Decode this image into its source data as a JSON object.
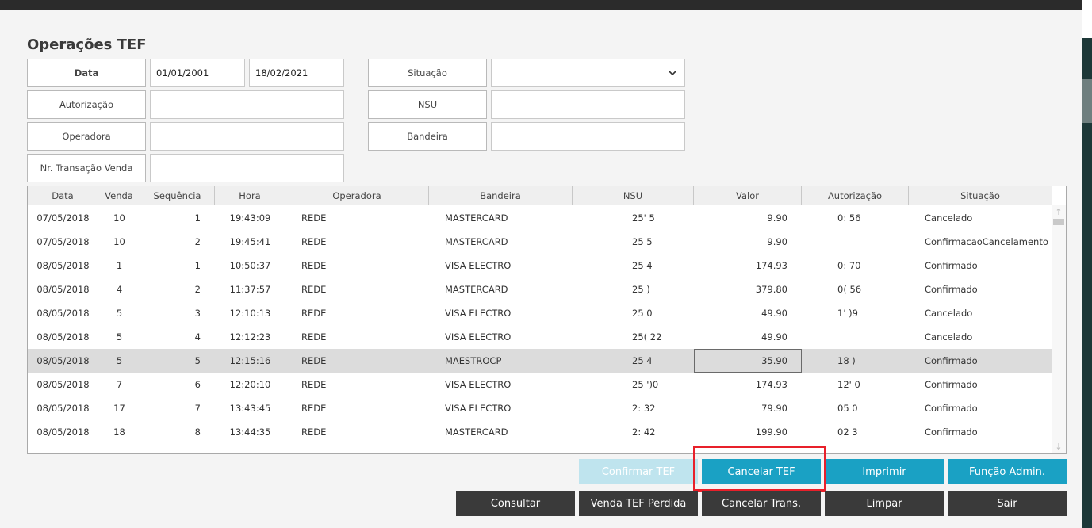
{
  "title": "Operações TEF",
  "filters": {
    "data_label": "Data",
    "data_from": "01/01/2001",
    "data_to": "18/02/2021",
    "autorizacao_label": "Autorização",
    "operadora_label": "Operadora",
    "nr_transacao_label": "Nr. Transação Venda",
    "situacao_label": "Situação",
    "situacao_value": "",
    "nsu_label": "NSU",
    "bandeira_label": "Bandeira"
  },
  "table": {
    "headers": [
      "Data",
      "Venda",
      "Sequência",
      "Hora",
      "Operadora",
      "Bandeira",
      "NSU",
      "Valor",
      "Autorização",
      "Situação"
    ],
    "rows": [
      {
        "data": "07/05/2018",
        "venda": "10",
        "seq": "1",
        "hora": "19:43:09",
        "operadora": "REDE",
        "bandeira": "MASTERCARD",
        "nsu": "25'      5",
        "valor": "9.90",
        "autorizacao": "0:   56",
        "situacao": "Cancelado"
      },
      {
        "data": "07/05/2018",
        "venda": "10",
        "seq": "2",
        "hora": "19:45:41",
        "operadora": "REDE",
        "bandeira": "MASTERCARD",
        "nsu": "25       5",
        "valor": "9.90",
        "autorizacao": "",
        "situacao": "ConfirmacaoCancelamento"
      },
      {
        "data": "08/05/2018",
        "venda": "1",
        "seq": "1",
        "hora": "10:50:37",
        "operadora": "REDE",
        "bandeira": "VISA ELECTRO",
        "nsu": "25       4",
        "valor": "174.93",
        "autorizacao": "0:   70",
        "situacao": "Confirmado"
      },
      {
        "data": "08/05/2018",
        "venda": "4",
        "seq": "2",
        "hora": "11:37:57",
        "operadora": "REDE",
        "bandeira": "MASTERCARD",
        "nsu": "25       )",
        "valor": "379.80",
        "autorizacao": "0(   56",
        "situacao": "Confirmado"
      },
      {
        "data": "08/05/2018",
        "venda": "5",
        "seq": "3",
        "hora": "12:10:13",
        "operadora": "REDE",
        "bandeira": "VISA ELECTRO",
        "nsu": "25       0",
        "valor": "49.90",
        "autorizacao": "1'   )9",
        "situacao": "Cancelado"
      },
      {
        "data": "08/05/2018",
        "venda": "5",
        "seq": "4",
        "hora": "12:12:23",
        "operadora": "REDE",
        "bandeira": "VISA ELECTRO",
        "nsu": "25(     22",
        "valor": "49.90",
        "autorizacao": "",
        "situacao": "Cancelado"
      },
      {
        "data": "08/05/2018",
        "venda": "5",
        "seq": "5",
        "hora": "12:15:16",
        "operadora": "REDE",
        "bandeira": "MAESTROCP",
        "nsu": "25       4",
        "valor": "35.90",
        "autorizacao": "18   )",
        "situacao": "Confirmado"
      },
      {
        "data": "08/05/2018",
        "venda": "7",
        "seq": "6",
        "hora": "12:20:10",
        "operadora": "REDE",
        "bandeira": "VISA ELECTRO",
        "nsu": "25    ')0",
        "valor": "174.93",
        "autorizacao": "12'  0",
        "situacao": "Confirmado"
      },
      {
        "data": "08/05/2018",
        "venda": "17",
        "seq": "7",
        "hora": "13:43:45",
        "operadora": "REDE",
        "bandeira": "VISA ELECTRO",
        "nsu": "2:      32",
        "valor": "79.90",
        "autorizacao": "05   0",
        "situacao": "Confirmado"
      },
      {
        "data": "08/05/2018",
        "venda": "18",
        "seq": "8",
        "hora": "13:44:35",
        "operadora": "REDE",
        "bandeira": "MASTERCARD",
        "nsu": "2:      42",
        "valor": "199.90",
        "autorizacao": "02   3",
        "situacao": "Confirmado"
      }
    ]
  },
  "buttons": {
    "confirmar_tef": "Confirmar TEF",
    "cancelar_tef": "Cancelar TEF",
    "imprimir": "Imprimir",
    "funcao_admin": "Função Admin.",
    "consultar": "Consultar",
    "venda_tef_perdida": "Venda TEF Perdida",
    "cancelar_trans": "Cancelar Trans.",
    "limpar": "Limpar",
    "sair": "Sair"
  },
  "colors": {
    "teal": "#1aa1c4",
    "dark": "#3a3a3a",
    "highlight": "#e8202a"
  },
  "icons": {
    "situacao_dropdown": "chevron-down-icon",
    "scroll_up": "arrow-up-icon",
    "scroll_down": "arrow-down-icon"
  }
}
